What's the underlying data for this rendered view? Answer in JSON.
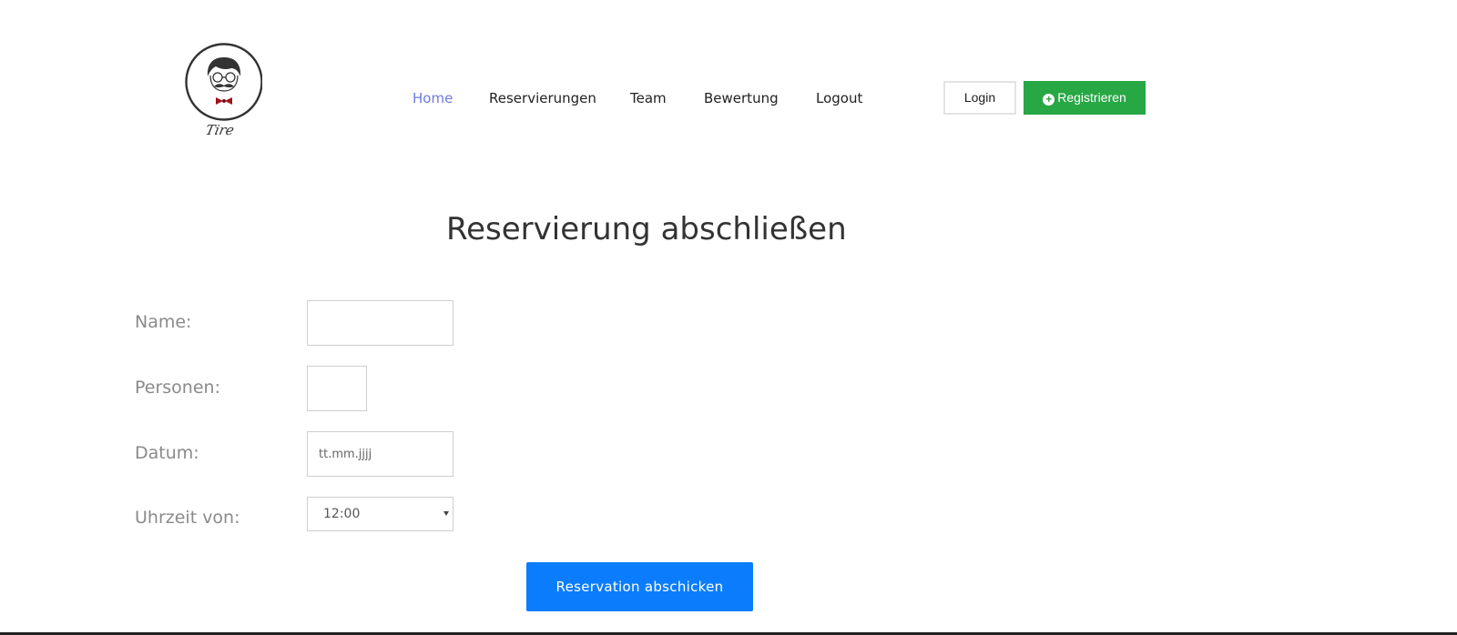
{
  "brand": {
    "logo_text": "Tire"
  },
  "nav": {
    "items": [
      {
        "label": "Home",
        "active": true
      },
      {
        "label": "Reservierungen",
        "active": false
      },
      {
        "label": "Team",
        "active": false
      },
      {
        "label": "Bewertung",
        "active": false
      },
      {
        "label": "Logout",
        "active": false
      }
    ]
  },
  "auth": {
    "login_label": "Login",
    "register_label": "Registrieren",
    "register_icon": "plus-circle-icon"
  },
  "page": {
    "title": "Reservierung abschließen"
  },
  "form": {
    "name_label": "Name:",
    "name_value": "",
    "persons_label": "Personen:",
    "persons_value": "",
    "date_label": "Datum:",
    "date_placeholder": "tt.mm.jjjj",
    "time_label": "Uhrzeit von:",
    "time_value": "12:00",
    "submit_label": "Reservation abschicken"
  },
  "colors": {
    "nav_active": "#6c7ae0",
    "register_button": "#28a745",
    "submit_button": "#0b7dfc",
    "label_text": "#8a8a8a"
  }
}
